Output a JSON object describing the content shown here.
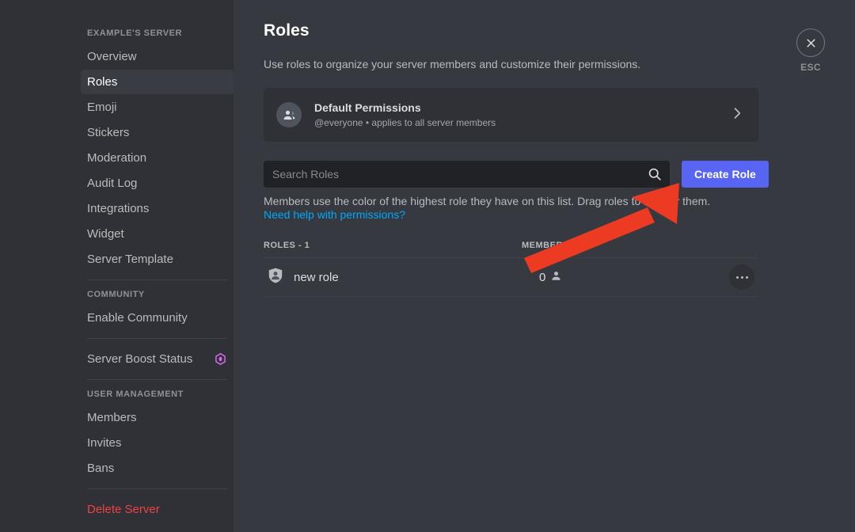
{
  "theme": {
    "sidebar_bg": "#2f3136",
    "main_bg": "#36393f",
    "accent": "#5865f2",
    "link": "#00a8fc",
    "danger": "#ed4245",
    "text_normal": "#dcddde",
    "text_muted": "#b9bbbe",
    "annotation_arrow": "#ec3a23",
    "boost_gem": "#d869f0"
  },
  "sidebar": {
    "groups": [
      {
        "label": "EXAMPLE'S SERVER",
        "items": [
          {
            "label": "Overview",
            "name": "sidebar-item-overview",
            "active": false
          },
          {
            "label": "Roles",
            "name": "sidebar-item-roles",
            "active": true
          },
          {
            "label": "Emoji",
            "name": "sidebar-item-emoji",
            "active": false
          },
          {
            "label": "Stickers",
            "name": "sidebar-item-stickers",
            "active": false
          },
          {
            "label": "Moderation",
            "name": "sidebar-item-moderation",
            "active": false
          },
          {
            "label": "Audit Log",
            "name": "sidebar-item-audit-log",
            "active": false
          },
          {
            "label": "Integrations",
            "name": "sidebar-item-integrations",
            "active": false
          },
          {
            "label": "Widget",
            "name": "sidebar-item-widget",
            "active": false
          },
          {
            "label": "Server Template",
            "name": "sidebar-item-server-template",
            "active": false
          }
        ]
      },
      {
        "label": "COMMUNITY",
        "items": [
          {
            "label": "Enable Community",
            "name": "sidebar-item-enable-community",
            "active": false
          }
        ]
      },
      {
        "label": "",
        "items": [
          {
            "label": "Server Boost Status",
            "name": "sidebar-item-server-boost-status",
            "active": false,
            "trailing_icon": "boost-gem-icon"
          }
        ]
      },
      {
        "label": "USER MANAGEMENT",
        "items": [
          {
            "label": "Members",
            "name": "sidebar-item-members",
            "active": false
          },
          {
            "label": "Invites",
            "name": "sidebar-item-invites",
            "active": false
          },
          {
            "label": "Bans",
            "name": "sidebar-item-bans",
            "active": false
          }
        ]
      },
      {
        "label": "",
        "items": [
          {
            "label": "Delete Server",
            "name": "sidebar-item-delete-server",
            "active": false,
            "danger": true
          }
        ]
      }
    ]
  },
  "page": {
    "title": "Roles",
    "subtitle": "Use roles to organize your server members and customize their permissions."
  },
  "default_permissions": {
    "title": "Default Permissions",
    "description": "@everyone • applies to all server members",
    "avatar_icon": "people-icon",
    "chevron_icon": "chevron-right-icon"
  },
  "search": {
    "placeholder": "Search Roles",
    "value": "",
    "icon": "search-icon"
  },
  "create_role_button": {
    "label": "Create Role"
  },
  "hint": {
    "text": "Members use the color of the highest role they have on this list. Drag roles to reorder them. ",
    "link_text": "Need help with permissions?"
  },
  "roles_table": {
    "columns": {
      "roles": "ROLES - 1",
      "members": "MEMBERS"
    },
    "rows": [
      {
        "role_icon": "shield-person-icon",
        "name": "new role",
        "member_count": "0",
        "member_icon": "person-icon",
        "actions_icon": "more-options-icon"
      }
    ]
  },
  "close": {
    "icon": "close-icon",
    "label": "ESC"
  },
  "annotation": {
    "type": "arrow",
    "points_at": "create-role-button",
    "color": "#ec3a23"
  }
}
